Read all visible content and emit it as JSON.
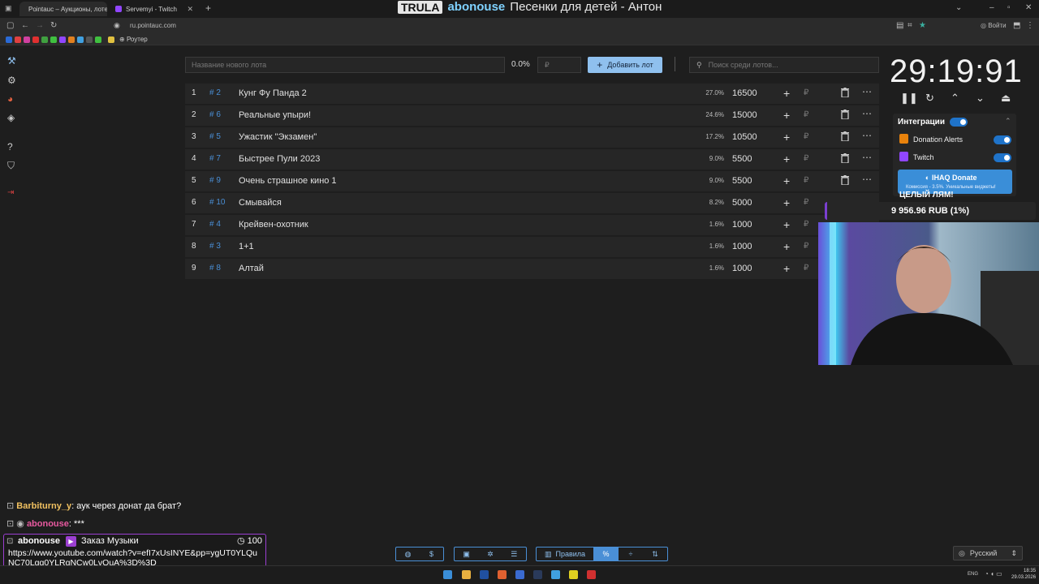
{
  "browser": {
    "tabs": [
      {
        "label": "Pointauc – Аукционы, лотереи",
        "active": true
      },
      {
        "label": "Servemyi - Twitch",
        "active": false
      }
    ],
    "url": "ru.pointauc.com",
    "bookmark_router": "Роутер",
    "login_label": "Войти"
  },
  "stream_overlay": {
    "badge": "TRULA",
    "channel": "abonouse",
    "now_playing": "Песенки для детей - Антон"
  },
  "toolbar": {
    "lot_placeholder": "Название нового лота",
    "percent_total": "0.0%",
    "amount_placeholder": "₽",
    "add_lot_label": "Добавить лот",
    "search_placeholder": "Поиск среди лотов..."
  },
  "lots": [
    {
      "num": "1",
      "fid": "# 2",
      "name": "Кунг Фу Панда 2",
      "pct": "27.0%",
      "amount": "16500"
    },
    {
      "num": "2",
      "fid": "# 6",
      "name": "Реальные упыри!",
      "pct": "24.6%",
      "amount": "15000"
    },
    {
      "num": "3",
      "fid": "# 5",
      "name": "Ужастик \"Экзамен\"",
      "pct": "17.2%",
      "amount": "10500"
    },
    {
      "num": "4",
      "fid": "# 7",
      "name": "Быстрее Пули 2023",
      "pct": "9.0%",
      "amount": "5500"
    },
    {
      "num": "5",
      "fid": "# 9",
      "name": "Очень страшное кино 1",
      "pct": "9.0%",
      "amount": "5500"
    },
    {
      "num": "6",
      "fid": "# 10",
      "name": "Смывайся",
      "pct": "8.2%",
      "amount": "5000"
    },
    {
      "num": "7",
      "fid": "# 4",
      "name": "Крейвен-охотник",
      "pct": "1.6%",
      "amount": "1000"
    },
    {
      "num": "8",
      "fid": "# 3",
      "name": "1+1",
      "pct": "1.6%",
      "amount": "1000"
    },
    {
      "num": "9",
      "fid": "# 8",
      "name": "Алтай",
      "pct": "1.6%",
      "amount": "1000"
    }
  ],
  "currency_symbol": "₽",
  "timer": {
    "value": "29:19:91"
  },
  "integrations": {
    "title": "Интеграции",
    "items": [
      {
        "label": "Donation Alerts",
        "enabled": true
      },
      {
        "label": "Twitch",
        "enabled": true
      }
    ]
  },
  "donate_banner": {
    "title": "IHAQ Donate",
    "subtitle": "Комиссия - 3.5%. Уникальные виджеты!"
  },
  "goal": {
    "title": "ЦЕЛЫЙ ЛЯМ!",
    "amount": "9 956.96 RUB (1%)",
    "progress_percent": 1
  },
  "chat": [
    {
      "user": "Barbiturny_y",
      "message": "аук через донат да брат?",
      "color": "#f0c060"
    },
    {
      "user": "abonouse",
      "message": "***",
      "color": "#e85aa0"
    }
  ],
  "music_order": {
    "user": "abonouse",
    "reward": "Заказ Музыки",
    "cost": "100",
    "link": "https://www.youtube.com/watch?v=efI7xUsINYE&pp=ygUT0YLQuNC70Lgg0YLRgNCw0LvQuA%3D%3D"
  },
  "bottom_toolbar": {
    "rules_label": "Правила"
  },
  "language": "Русский",
  "taskbar": {
    "lang": "ENG",
    "time": "18:35",
    "date": "29.03.2026"
  },
  "colors": {
    "accent": "#8fc0ee",
    "toggle": "#1f73c9",
    "lot_id": "#4a8fd6",
    "order_border": "#9b3fd1"
  }
}
